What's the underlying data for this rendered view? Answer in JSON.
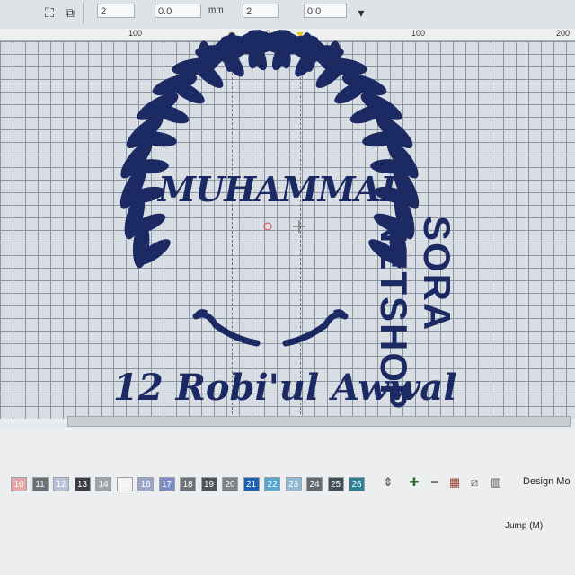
{
  "toolbar": {
    "inputs": [
      {
        "name": "stitch-size-input",
        "value": "2"
      },
      {
        "name": "angle-input",
        "value": "0.0"
      },
      {
        "name": "length-input",
        "value": "2"
      },
      {
        "name": "offset-input",
        "value": "0.0"
      }
    ],
    "unit_label": "mm"
  },
  "ruler": {
    "ticks": [
      "100",
      "0",
      "100",
      "200"
    ]
  },
  "design": {
    "title_text": "MUHAMMAD",
    "date_text": "12 Robi'ul Awwal",
    "vertical_text": "SORA NETSHOP",
    "thread_color": "#1c2a63"
  },
  "palette": {
    "swatches": [
      {
        "n": "10",
        "color": "#e7a5a5"
      },
      {
        "n": "11",
        "color": "#6c6f73"
      },
      {
        "n": "12",
        "color": "#b9c2da"
      },
      {
        "n": "13",
        "color": "#3b3d40"
      },
      {
        "n": "14",
        "color": "#9fa4a8"
      },
      {
        "n": "15",
        "color": "#f2f2f2"
      },
      {
        "n": "16",
        "color": "#9aa6c8"
      },
      {
        "n": "17",
        "color": "#7b8cc7"
      },
      {
        "n": "18",
        "color": "#6e7378"
      },
      {
        "n": "19",
        "color": "#4f5356"
      },
      {
        "n": "20",
        "color": "#7d8286"
      },
      {
        "n": "21",
        "color": "#1f5fb0"
      },
      {
        "n": "22",
        "color": "#55a8d6"
      },
      {
        "n": "23",
        "color": "#8fb9d2"
      },
      {
        "n": "24",
        "color": "#5f6a72"
      },
      {
        "n": "25",
        "color": "#42505a"
      },
      {
        "n": "26",
        "color": "#2f7f97"
      }
    ],
    "design_mode_label": "Design Mo",
    "jump_label": "Jump (M)"
  }
}
